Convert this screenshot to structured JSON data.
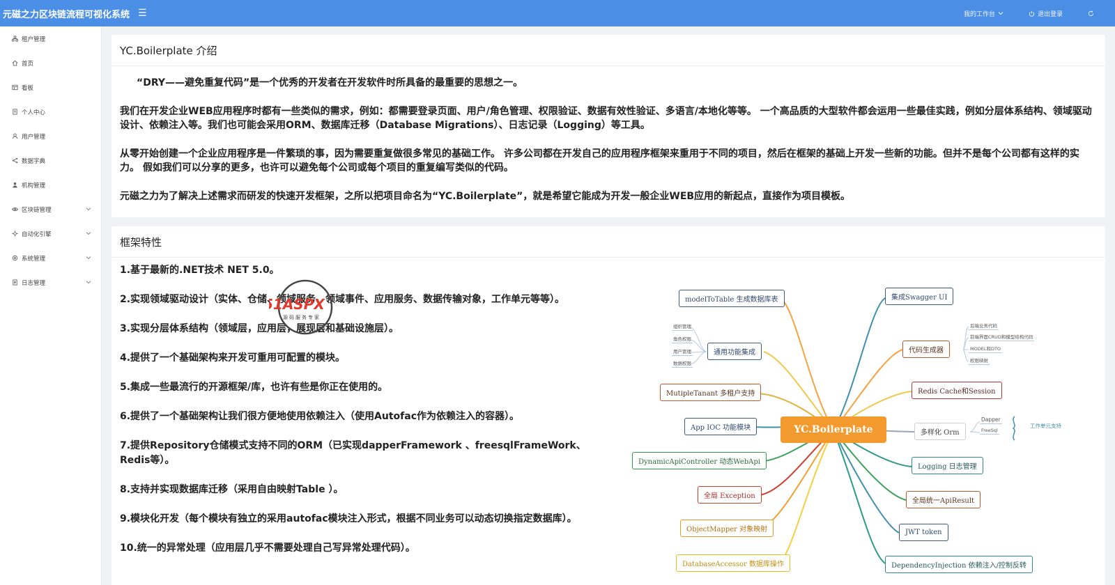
{
  "header": {
    "title": "元磁之力区块链流程可视化系统",
    "workspace": "我的工作台",
    "logout": "退出登录"
  },
  "sidebar": {
    "items": [
      {
        "label": "租户管理",
        "icon": "cluster-icon",
        "expandable": false
      },
      {
        "label": "首页",
        "icon": "home-icon",
        "expandable": false
      },
      {
        "label": "看板",
        "icon": "dashboard-icon",
        "expandable": false
      },
      {
        "label": "个人中心",
        "icon": "profile-icon",
        "expandable": false
      },
      {
        "label": "用户管理",
        "icon": "user-icon",
        "expandable": false
      },
      {
        "label": "数据字典",
        "icon": "share-icon",
        "expandable": false
      },
      {
        "label": "机构管理",
        "icon": "org-icon",
        "expandable": false
      },
      {
        "label": "区块链管理",
        "icon": "eye-icon",
        "expandable": true
      },
      {
        "label": "自动化引擎",
        "icon": "engine-icon",
        "expandable": true
      },
      {
        "label": "系统管理",
        "icon": "settings-icon",
        "expandable": true
      },
      {
        "label": "日志管理",
        "icon": "log-icon",
        "expandable": true
      }
    ]
  },
  "intro": {
    "title": "YC.Boilerplate 介绍",
    "paragraphs": [
      "“DRY——避免重复代码”是一个优秀的开发者在开发软件时所具备的最重要的思想之一。",
      "我们在开发企业WEB应用程序时都有一些类似的需求，例如：都需要登录页面、用户/角色管理、权限验证、数据有效性验证、多语言/本地化等等。 一个高品质的大型软件都会运用一些最佳实践，例如分层体系结构、领域驱动设计、依赖注入等。我们也可能会采用ORM、数据库迁移（Database Migrations）、日志记录（Logging）等工具。",
      "从零开始创建一个企业应用程序是一件繁琐的事，因为需要重复做很多常见的基础工作。 许多公司都在开发自己的应用程序框架来重用于不同的项目，然后在框架的基础上开发一些新的功能。但并不是每个公司都有这样的实力。 假如我们可以分享的更多，也许可以避免每个公司或每个项目的重复编写类似的代码。",
      "元磁之力为了解决上述需求而研发的快速开发框架，之所以把项目命名为“YC.Boilerplate”，就是希望它能成为开发一般企业WEB应用的新起点，直接作为项目模板。"
    ]
  },
  "features": {
    "title": "框架特性",
    "items": [
      "1.基于最新的.NET技术 NET 5.0。",
      "2.实现领域驱动设计（实体、仓储、领域服务、领域事件、应用服务、数据传输对象，工作单元等等）。",
      "3.实现分层体系结构（领域层，应用层，展现层和基础设施层）。",
      "4.提供了一个基础架构来开发可重用可配置的模块。",
      "5.集成一些最流行的开源框架/库，也许有些是你正在使用的。",
      "6.提供了一个基础架构让我们很方便地使用依赖注入（使用Autofac作为依赖注入的容器）。",
      "7.提供Repository仓储模式支持不同的ORM（已实现dapperFramework 、freesqlFrameWork、Redis等）。",
      "8.支持并实现数据库迁移（采用自由映射Table ）。",
      "9.模块化开发（每个模块有独立的采用autofac模块注入形式，根据不同业务可以动态切换指定数据库）。",
      "10.统一的异常处理（应用层几乎不需要处理自己写异常处理代码）。"
    ]
  },
  "watermark": {
    "brand": "51ASPX",
    "tagline": "源码服务专家"
  },
  "mindmap": {
    "center": "YC.Boilerplate",
    "left": [
      {
        "label": "modelToTable 生成数据库表",
        "color": "#3d5a80"
      },
      {
        "label": "通用功能集成",
        "color": "#3d5a80"
      },
      {
        "label": "MutipleTanant 多租户支持",
        "color": "#c05a2a"
      },
      {
        "label": "App IOC 功能模块",
        "color": "#3d5a80"
      },
      {
        "label": "DynamicApiController 动态WebApi",
        "color": "#2e9a4a"
      },
      {
        "label": "全局 Exception",
        "color": "#d23c2c"
      },
      {
        "label": "ObjectMapper 对象映射",
        "color": "#e0a020"
      },
      {
        "label": "DatabaseAccessor 数据库操作",
        "color": "#e8c020"
      }
    ],
    "common_leaves": [
      "组织管理",
      "角色权限",
      "用户管理",
      "数据权限"
    ],
    "right": [
      {
        "label": "集成Swagger UI",
        "color": "#3d5a80"
      },
      {
        "label": "代码生成器",
        "color": "#c05a2a"
      },
      {
        "label": "Redis Cache和Session",
        "color": "#b03a3a"
      },
      {
        "label": "多样化 Orm",
        "color": "#888888"
      },
      {
        "label": "Logging 日志管理",
        "color": "#2e8a8a"
      },
      {
        "label": "全局统一ApiResult",
        "color": "#c05a2a"
      },
      {
        "label": "JWT token",
        "color": "#3d5a80"
      },
      {
        "label": "DependencyInjection 依赖注入/控制反转",
        "color": "#2e8a8a"
      }
    ],
    "codegen_leaves": [
      "后端业务代码",
      "前端界面CRUD和模型结构代码",
      "MODEL和DTO",
      "权限映射"
    ],
    "orm_leaves": [
      "Dapper",
      "FreeSql"
    ],
    "orm_note": "工作单元支持"
  }
}
